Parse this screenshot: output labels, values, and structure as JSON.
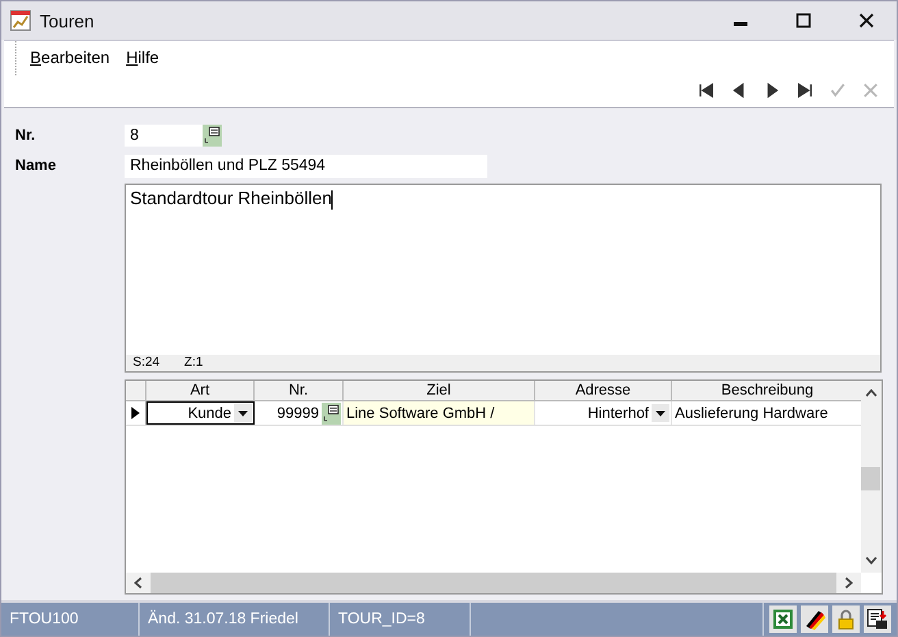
{
  "window": {
    "title": "Touren"
  },
  "menu": [
    {
      "label": "Bearbeiten"
    },
    {
      "label": "Hilfe"
    }
  ],
  "navigation": [
    {
      "kind": "first",
      "disabled": false
    },
    {
      "kind": "prev",
      "disabled": false
    },
    {
      "kind": "next",
      "disabled": false
    },
    {
      "kind": "last",
      "disabled": false
    },
    {
      "kind": "confirm",
      "disabled": true
    },
    {
      "kind": "cancel",
      "disabled": true
    }
  ],
  "form": {
    "nr": {
      "label": "Nr.",
      "value": "8"
    },
    "name": {
      "label": "Name",
      "value": "Rheinböllen und PLZ 55494"
    },
    "memo": {
      "value": "Standardtour Rheinböllen",
      "column": "S:24",
      "line": "Z:1"
    }
  },
  "table": {
    "columns": [
      "Art",
      "Nr.",
      "Ziel",
      "Adresse",
      "Beschreibung"
    ],
    "rows": [
      {
        "selected": true,
        "art": "Kunde",
        "nr": "99999",
        "ziel": "Line Software GmbH /",
        "adresse": "Hinterhof",
        "beschreibung": "Auslieferung Hardware"
      }
    ]
  },
  "status_bar": {
    "panels": [
      "FTOU100",
      "Änd. 31.07.18 Friedel",
      "TOUR_ID=8"
    ]
  }
}
